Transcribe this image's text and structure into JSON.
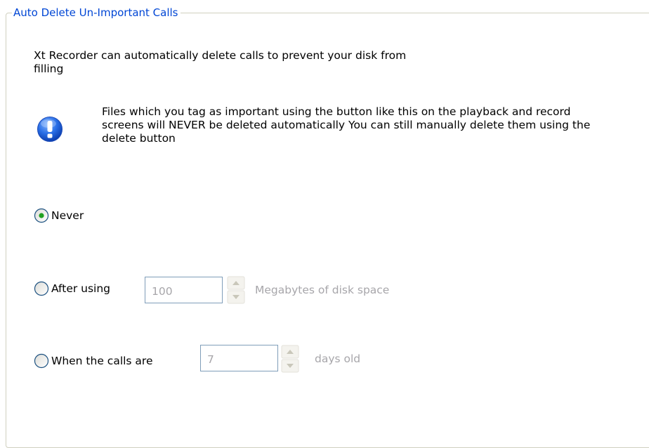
{
  "group": {
    "title": "Auto Delete Un-Important Calls"
  },
  "intro": {
    "text": "Xt Recorder can automatically delete calls to prevent your disk from filling"
  },
  "info": {
    "icon": "exclamation-info-icon",
    "text": "Files which you tag as important using the button like this on the playback and record screens will NEVER be deleted automatically You can still manually delete them using the delete button"
  },
  "options": {
    "never": {
      "label": "Never",
      "selected": true
    },
    "after_using": {
      "label": "After using",
      "selected": false,
      "value": "100",
      "unit": "Megabytes of disk space"
    },
    "when_calls_are": {
      "label": "When the calls are",
      "selected": false,
      "value": "7",
      "unit": "days old"
    }
  },
  "colors": {
    "group_title": "#0046d5",
    "group_border": "#d0d0bf",
    "disabled_text": "#a7a6aa",
    "input_border": "#7f9db9",
    "radio_selected_dot": "#21a121"
  }
}
